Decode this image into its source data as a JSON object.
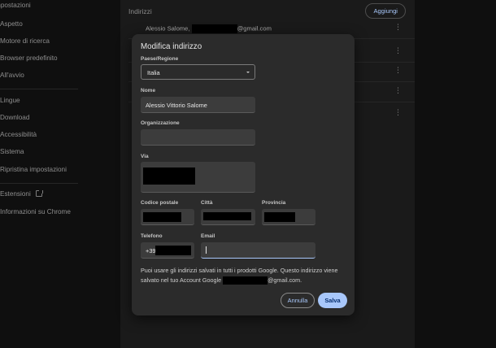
{
  "sidebar": {
    "items": [
      {
        "label": "mpostazioni"
      },
      {
        "label": "Aspetto"
      },
      {
        "label": "Motore di ricerca"
      },
      {
        "label": "Browser predefinito"
      },
      {
        "label": "All'avvio"
      },
      {
        "label": "Lingue"
      },
      {
        "label": "Download"
      },
      {
        "label": "Accessibilità"
      },
      {
        "label": "Sistema"
      },
      {
        "label": "Ripristina impostazioni"
      },
      {
        "label": "Estensioni"
      },
      {
        "label": "Informazioni su Chrome"
      }
    ]
  },
  "addresses": {
    "title": "Indirizzi",
    "add_label": "Aggiungi",
    "rows": [
      {
        "name": "Alessio Salome,",
        "email_suffix": "@gmail.com"
      }
    ]
  },
  "dialog": {
    "title": "Modifica indirizzo",
    "country": {
      "label": "Paese/Regione",
      "value": "Italia"
    },
    "name": {
      "label": "Nome",
      "value": "Alessio Vittorio Salome"
    },
    "organization": {
      "label": "Organizzazione",
      "value": ""
    },
    "street": {
      "label": "Via"
    },
    "postal_code": {
      "label": "Codice postale"
    },
    "city": {
      "label": "Città"
    },
    "province": {
      "label": "Provincia"
    },
    "phone": {
      "label": "Telefono",
      "prefix": "+39"
    },
    "email": {
      "label": "Email",
      "value": ""
    },
    "note_line1": "Puoi usare gli indirizzi salvati in tutti i prodotti Google. Questo indirizzo viene",
    "note_line2_a": "salvato nel tuo Account Google",
    "note_line2_b": "@gmail.com.",
    "cancel_label": "Annulla",
    "save_label": "Salva"
  }
}
